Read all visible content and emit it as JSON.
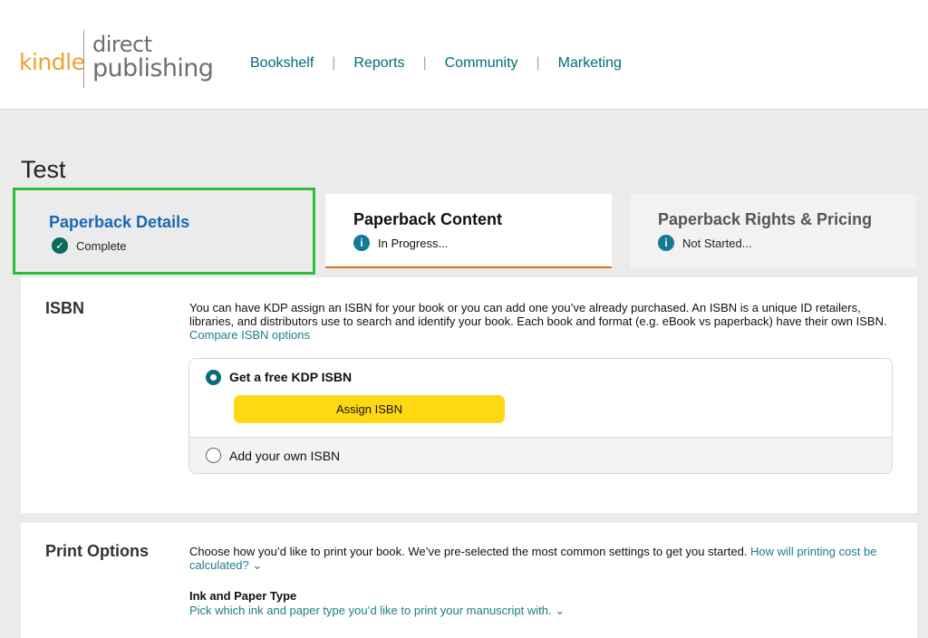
{
  "logo": {
    "kindle": "kindle",
    "direct": "direct",
    "publishing": "publishing"
  },
  "nav": [
    "Bookshelf",
    "Reports",
    "Community",
    "Marketing"
  ],
  "nav_separator": "|",
  "page_title": "Test",
  "tabs": [
    {
      "title": "Paperback Details",
      "status": "Complete",
      "status_icon": "check-circle-icon",
      "icon_glyph": "✓",
      "icon_color": "#0a6b5a"
    },
    {
      "title": "Paperback Content",
      "status": "In Progress...",
      "status_icon": "info-icon",
      "icon_glyph": "i",
      "icon_color": "#127a94"
    },
    {
      "title": "Paperback Rights & Pricing",
      "status": "Not Started...",
      "status_icon": "info-icon",
      "icon_glyph": "i",
      "icon_color": "#127a94"
    }
  ],
  "isbn": {
    "label": "ISBN",
    "description": "You can have KDP assign an ISBN for your book or you can add one you’ve already purchased. An ISBN is a unique ID retailers, libraries, and distributors use to search and identify your book. Each book and format (e.g. eBook vs paperback) have their own ISBN.",
    "compare_link": "Compare ISBN options",
    "option_free": "Get a free KDP ISBN",
    "assign_button": "Assign ISBN",
    "option_own": "Add your own ISBN"
  },
  "print_options": {
    "label": "Print Options",
    "description": "Choose how you’d like to print your book. We’ve pre-selected the most common settings to get you started.",
    "cost_link": "How will printing cost be calculated?",
    "ink_title": "Ink and Paper Type",
    "ink_link": "Pick which ink and paper type you’d like to print your manuscript with."
  },
  "chevron": "⌄",
  "colors": {
    "accent_teal": "#0a6b7a",
    "tab_link_blue": "#1a68b3",
    "assign_yellow": "#ffd814",
    "highlight_green": "#2ebd3a",
    "active_tab_underline": "#e07020"
  }
}
